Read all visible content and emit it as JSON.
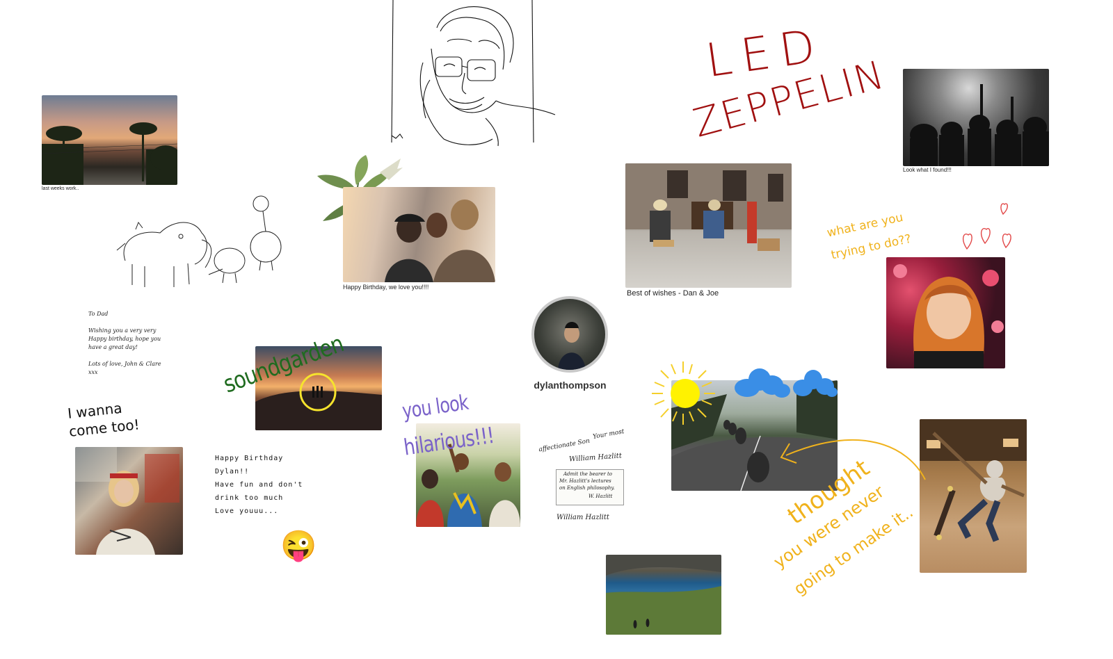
{
  "board": {
    "background": "#ffffff"
  },
  "captions": {
    "sunset": "last weeks work..",
    "concert": "Look what I found!!!",
    "friends": "Happy Birthday, we love you!!!!",
    "street": "Best of wishes - Dan & Joe"
  },
  "profile": {
    "username": "dylanthompson"
  },
  "handwriting": {
    "led_line1": "LED",
    "led_line2": "ZEPPELIN",
    "what_line1": "what are you",
    "what_line2": "trying to do??",
    "soundgarden": "soundgarden",
    "wanna_line1": "I wanna",
    "wanna_line2": "come too!",
    "hilarious_line1": "you look",
    "hilarious_line2": "hilarious!!!",
    "thought_line1": "thought",
    "thought_line2": "you were never",
    "thought_line3": "going to make it.."
  },
  "notes": {
    "dad": {
      "line1": "To Dad",
      "line2": "Wishing you a very very",
      "line3": "Happy birthday, hope you",
      "line4": "have a great day!",
      "line5": "Lots of love, John & Clare",
      "line6": "xxx"
    },
    "birthday": {
      "line1": "Happy Birthday",
      "line2": "Dylan!!",
      "line3": "Have fun and don't",
      "line4": "drink too much",
      "line5": "Love youuu..."
    },
    "hazlitt": {
      "line1": "Your most",
      "line2": "affectionate Son",
      "line3": "William Hazlitt",
      "card1": "Admit the bearer to",
      "card2": "Mr. Hazlitt's lectures",
      "card3": "on English philosophy.",
      "card4": "W. Hazlitt",
      "signature": "William Hazlitt"
    }
  },
  "icons": {
    "emoji": "😜",
    "sun": "sun-icon",
    "cloud": "cloud-icon",
    "heart": "heart-icon"
  },
  "colors": {
    "led_red": "#a01010",
    "orange_ink": "#f0b21c",
    "green_ink": "#1f6b1f",
    "purple_ink": "#7a62c9",
    "cloud_blue": "#3a8ee6",
    "sun_yellow": "#fff200"
  }
}
